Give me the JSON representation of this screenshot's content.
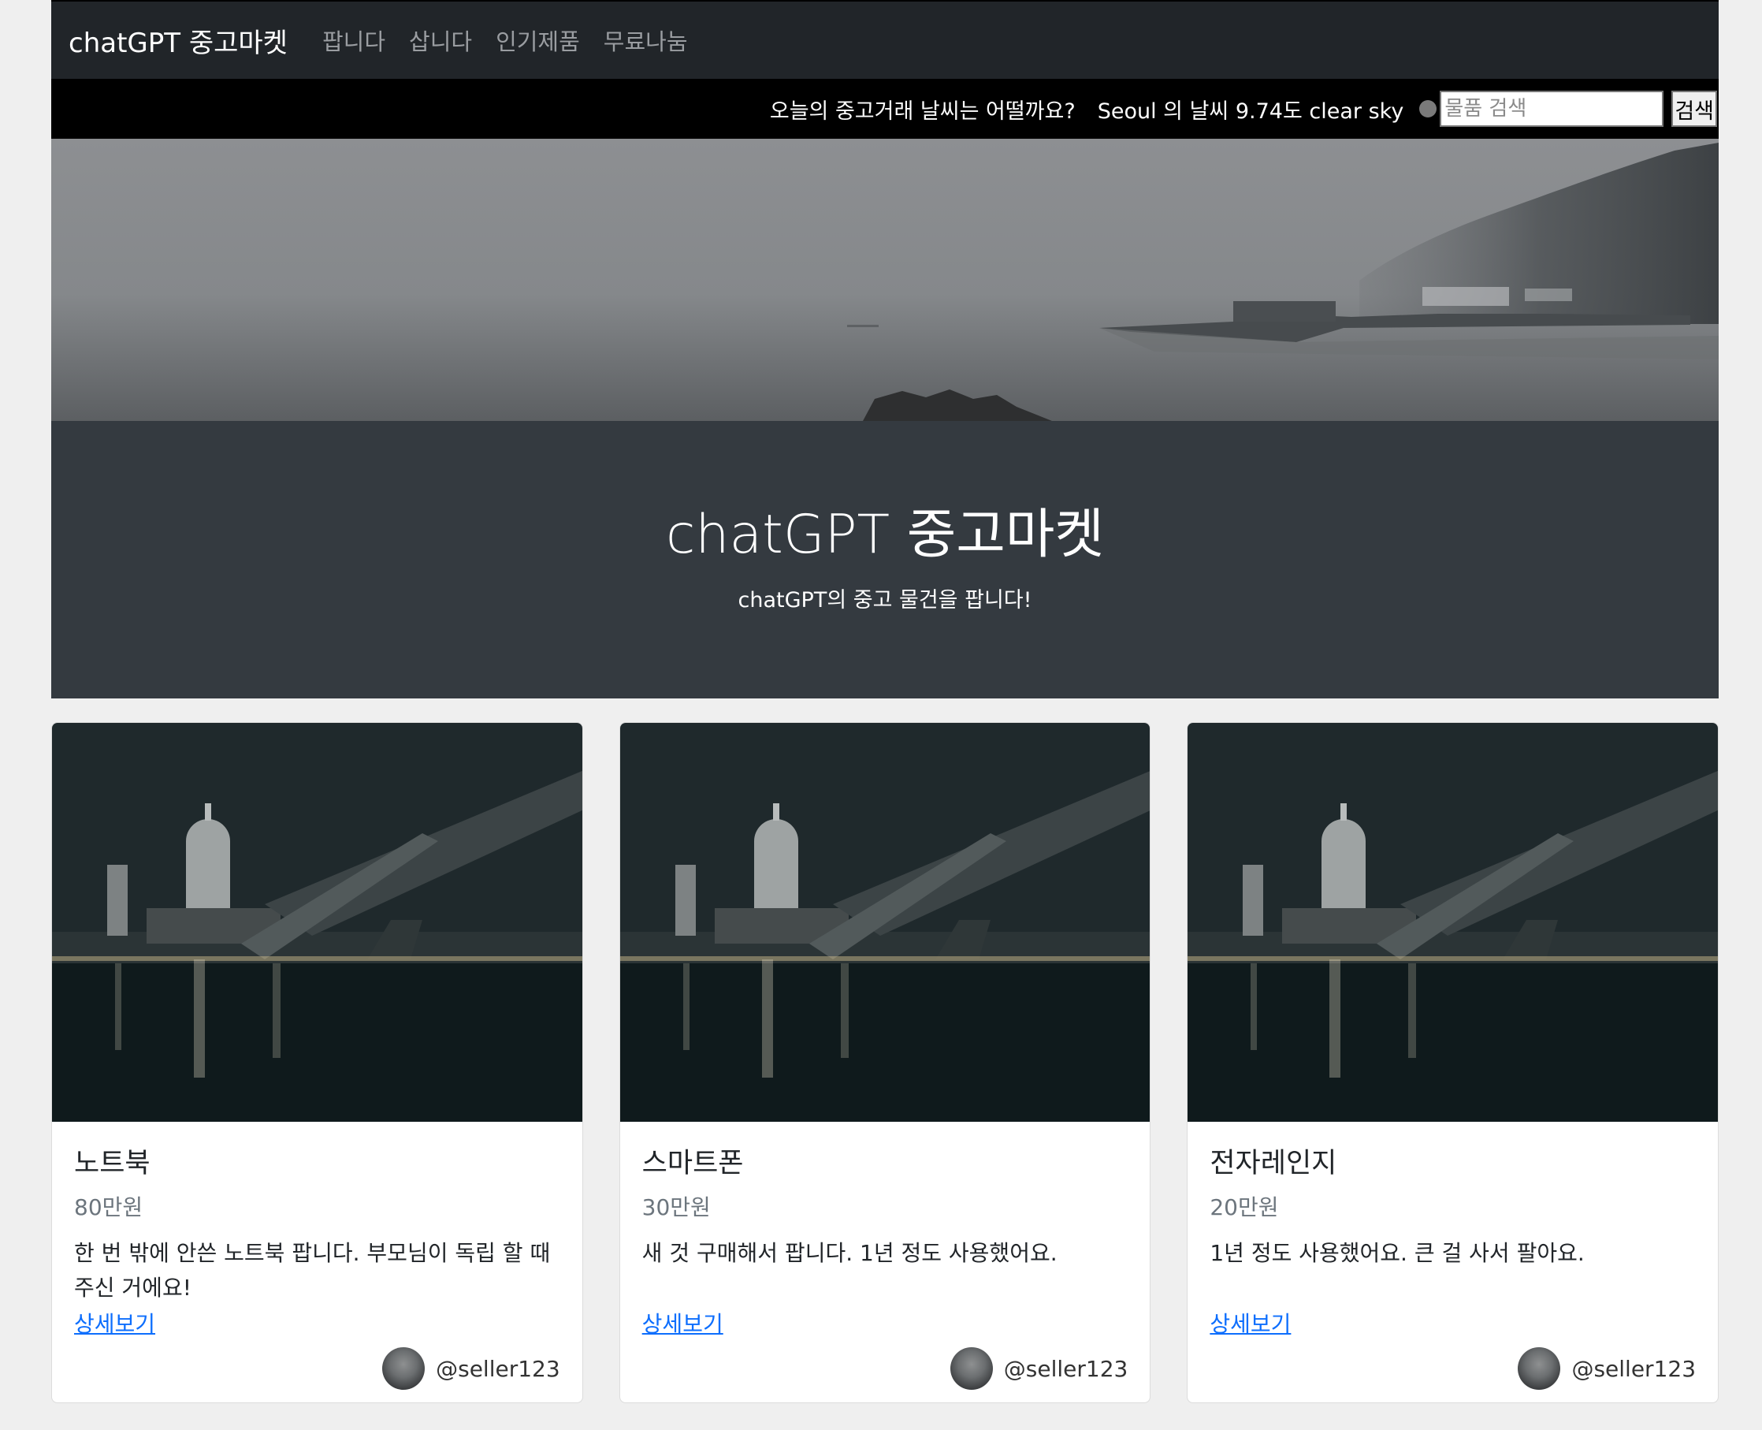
{
  "navbar": {
    "brand": "chatGPT 중고마켓",
    "links": [
      "팝니다",
      "삽니다",
      "인기제품",
      "무료나눔"
    ]
  },
  "topbar": {
    "weather_question": "오늘의 중고거래 날씨는 어떨까요?",
    "weather_info": "Seoul 의 날씨 9.74도 clear sky",
    "search_placeholder": "물품 검색",
    "search_button": "검색"
  },
  "hero": {
    "title": "chatGPT 중고마켓",
    "subtitle": "chatGPT의 중고 물건을 팝니다!"
  },
  "cards": [
    {
      "title": "노트북",
      "price": "80만원",
      "description": "한 번 밖에 안쓴 노트북 팝니다. 부모님이 독립 할 때 주신 거에요!",
      "link": "상세보기",
      "seller": "@seller123"
    },
    {
      "title": "스마트폰",
      "price": "30만원",
      "description": "새 것 구매해서 팝니다. 1년 정도 사용했어요.",
      "link": "상세보기",
      "seller": "@seller123"
    },
    {
      "title": "전자레인지",
      "price": "20만원",
      "description": "1년 정도 사용했어요. 큰 걸 사서 팔아요.",
      "link": "상세보기",
      "seller": "@seller123"
    }
  ],
  "colors": {
    "navbar_bg": "#212529",
    "hero_bg": "#343a40",
    "link": "#0d6efd"
  }
}
